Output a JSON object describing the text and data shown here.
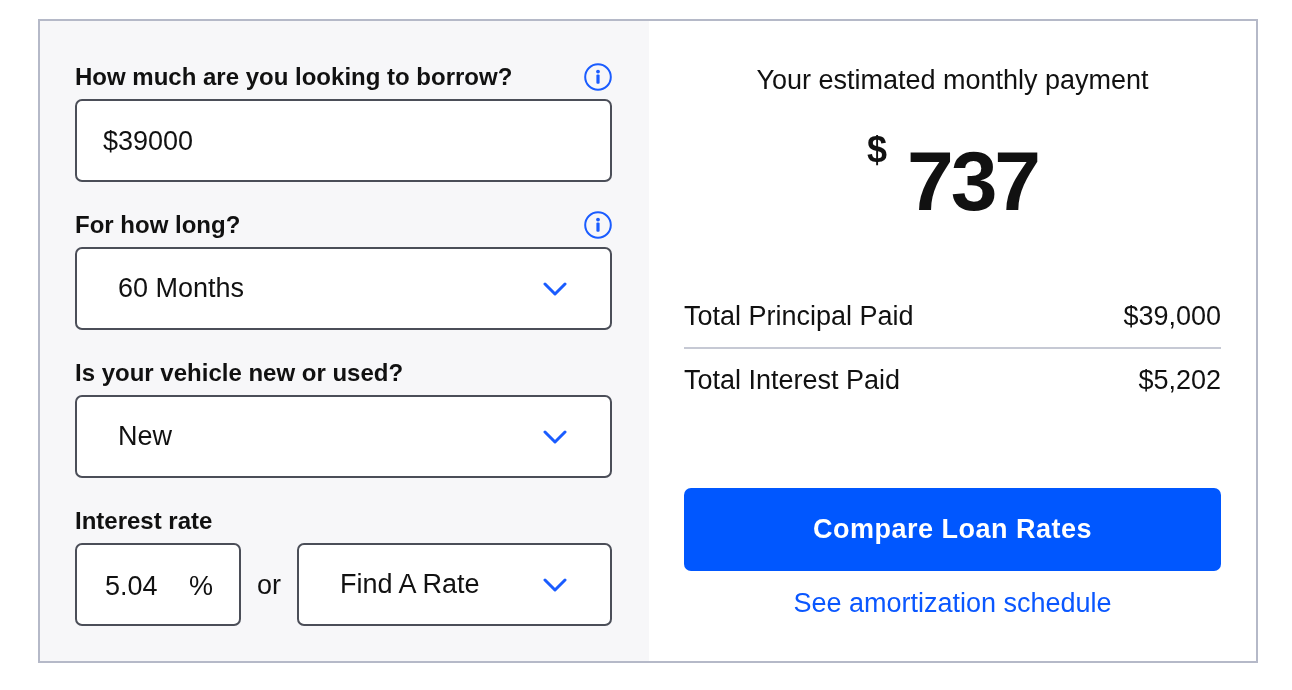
{
  "loan_form": {
    "fields": [
      {
        "label": "How much are you looking to borrow?",
        "kind": "text",
        "value": "$39000",
        "has_info": true
      },
      {
        "label": "For how long?",
        "kind": "select",
        "value": "60 Months",
        "has_info": true
      },
      {
        "label": "Is your vehicle new or used?",
        "kind": "select",
        "value": "New",
        "has_info": false
      },
      {
        "label": "Interest rate",
        "kind": "rate",
        "value": "5.04",
        "unit": "%",
        "separator": "or",
        "option": "Find A Rate",
        "has_info": false
      }
    ]
  },
  "results": {
    "title": "Your estimated monthly payment",
    "currency": "$",
    "amount": "737",
    "rows": [
      {
        "label": "Total Principal Paid",
        "value": "$39,000"
      },
      {
        "label": "Total Interest Paid",
        "value": "$5,202"
      }
    ],
    "button": "Compare Loan Rates",
    "link": "See amortization schedule"
  }
}
